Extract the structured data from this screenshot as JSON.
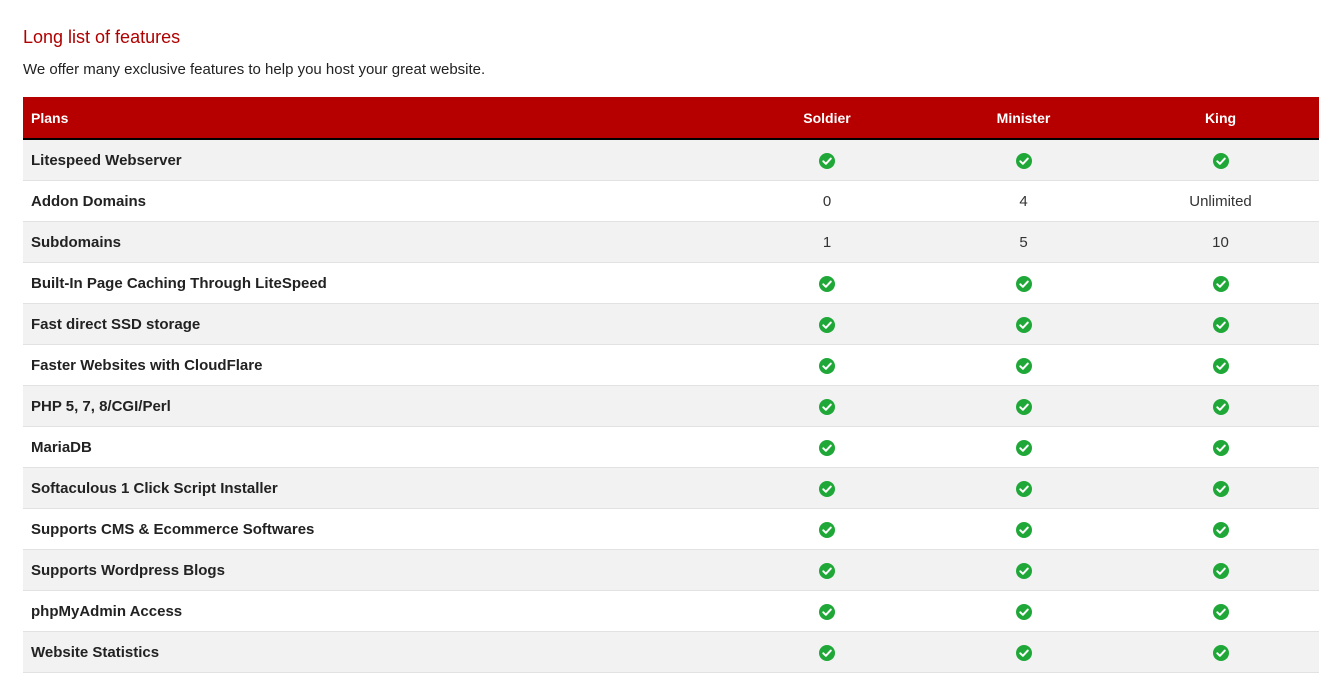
{
  "section": {
    "title": "Long list of features",
    "subtitle": "We offer many exclusive features to help you host your great website."
  },
  "colors": {
    "accent": "#b60000",
    "title": "#b00000",
    "check": "#1fa838",
    "row_alt": "#f2f2f2"
  },
  "table": {
    "headers": [
      "Plans",
      "Soldier",
      "Minister",
      "King"
    ],
    "rows": [
      {
        "feature": "Litespeed Webserver",
        "values": [
          "check-icon",
          "check-icon",
          "check-icon"
        ]
      },
      {
        "feature": "Addon Domains",
        "values": [
          "0",
          "4",
          "Unlimited"
        ]
      },
      {
        "feature": "Subdomains",
        "values": [
          "1",
          "5",
          "10"
        ]
      },
      {
        "feature": "Built-In Page Caching Through LiteSpeed",
        "values": [
          "check-icon",
          "check-icon",
          "check-icon"
        ]
      },
      {
        "feature": "Fast direct SSD storage",
        "values": [
          "check-icon",
          "check-icon",
          "check-icon"
        ]
      },
      {
        "feature": "Faster Websites with CloudFlare",
        "values": [
          "check-icon",
          "check-icon",
          "check-icon"
        ]
      },
      {
        "feature": "PHP 5, 7, 8/CGI/Perl",
        "values": [
          "check-icon",
          "check-icon",
          "check-icon"
        ]
      },
      {
        "feature": "MariaDB",
        "values": [
          "check-icon",
          "check-icon",
          "check-icon"
        ]
      },
      {
        "feature": "Softaculous 1 Click Script Installer",
        "values": [
          "check-icon",
          "check-icon",
          "check-icon"
        ]
      },
      {
        "feature": "Supports CMS & Ecommerce Softwares",
        "values": [
          "check-icon",
          "check-icon",
          "check-icon"
        ]
      },
      {
        "feature": "Supports Wordpress Blogs",
        "values": [
          "check-icon",
          "check-icon",
          "check-icon"
        ]
      },
      {
        "feature": "phpMyAdmin Access",
        "values": [
          "check-icon",
          "check-icon",
          "check-icon"
        ]
      },
      {
        "feature": "Website Statistics",
        "values": [
          "check-icon",
          "check-icon",
          "check-icon"
        ]
      }
    ]
  }
}
